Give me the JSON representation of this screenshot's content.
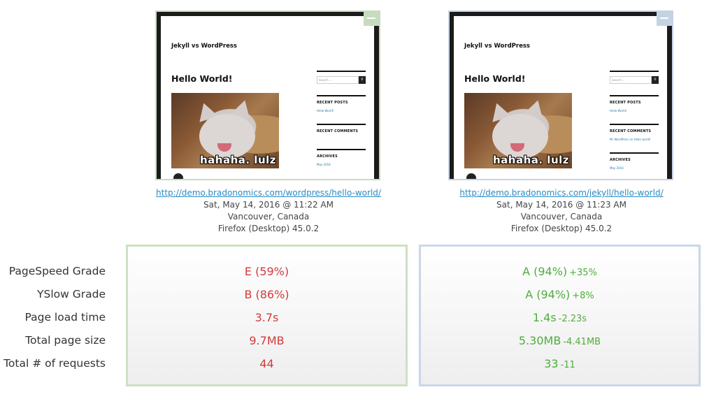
{
  "thumbnails": [
    {
      "site_title": "Jekyll vs WordPress",
      "post_title": "Hello World!",
      "image_caption": "hahaha. lulz",
      "search_placeholder": "Search ...",
      "sidebar": {
        "recent_posts": "RECENT POSTS",
        "recent_posts_item": "Hello World!",
        "recent_comments": "RECENT COMMENTS",
        "recent_comments_item": "",
        "archives": "ARCHIVES",
        "archives_item": "May 2016"
      }
    },
    {
      "site_title": "Jekyll vs WordPress",
      "post_title": "Hello World!",
      "image_caption": "hahaha. lulz",
      "search_placeholder": "Search ...",
      "sidebar": {
        "recent_posts": "RECENT POSTS",
        "recent_posts_item": "Hello World!",
        "recent_comments": "RECENT COMMENTS",
        "recent_comments_item": "Mr WordPress on Hello world!",
        "archives": "ARCHIVES",
        "archives_item": "May 2016"
      }
    }
  ],
  "tests": [
    {
      "url": "http://demo.bradonomics.com/wordpress/hello-world/",
      "date": "Sat, May 14, 2016 @ 11:22 AM",
      "location": "Vancouver, Canada",
      "browser": "Firefox (Desktop) 45.0.2"
    },
    {
      "url": "http://demo.bradonomics.com/jekyll/hello-world/",
      "date": "Sat, May 14, 2016 @ 11:23 AM",
      "location": "Vancouver, Canada",
      "browser": "Firefox (Desktop) 45.0.2"
    }
  ],
  "metric_labels": [
    "PageSpeed Grade",
    "YSlow Grade",
    "Page load time",
    "Total page size",
    "Total # of requests"
  ],
  "wordpress": {
    "values": [
      "E (59%)",
      "B (86%)",
      "3.7s",
      "9.7MB",
      "44"
    ]
  },
  "jekyll": {
    "values": [
      "A (94%)",
      "A (94%)",
      "1.4s",
      "5.30MB",
      "33"
    ],
    "deltas": [
      "+35%",
      "+8%",
      "-2.23s",
      "-4.41MB",
      "-11"
    ]
  },
  "colors": {
    "worse": "#d33a3a",
    "better": "#4fae3d",
    "left_border": "#cde0c4",
    "right_border": "#c9d7e8",
    "link": "#2a8bc4"
  }
}
